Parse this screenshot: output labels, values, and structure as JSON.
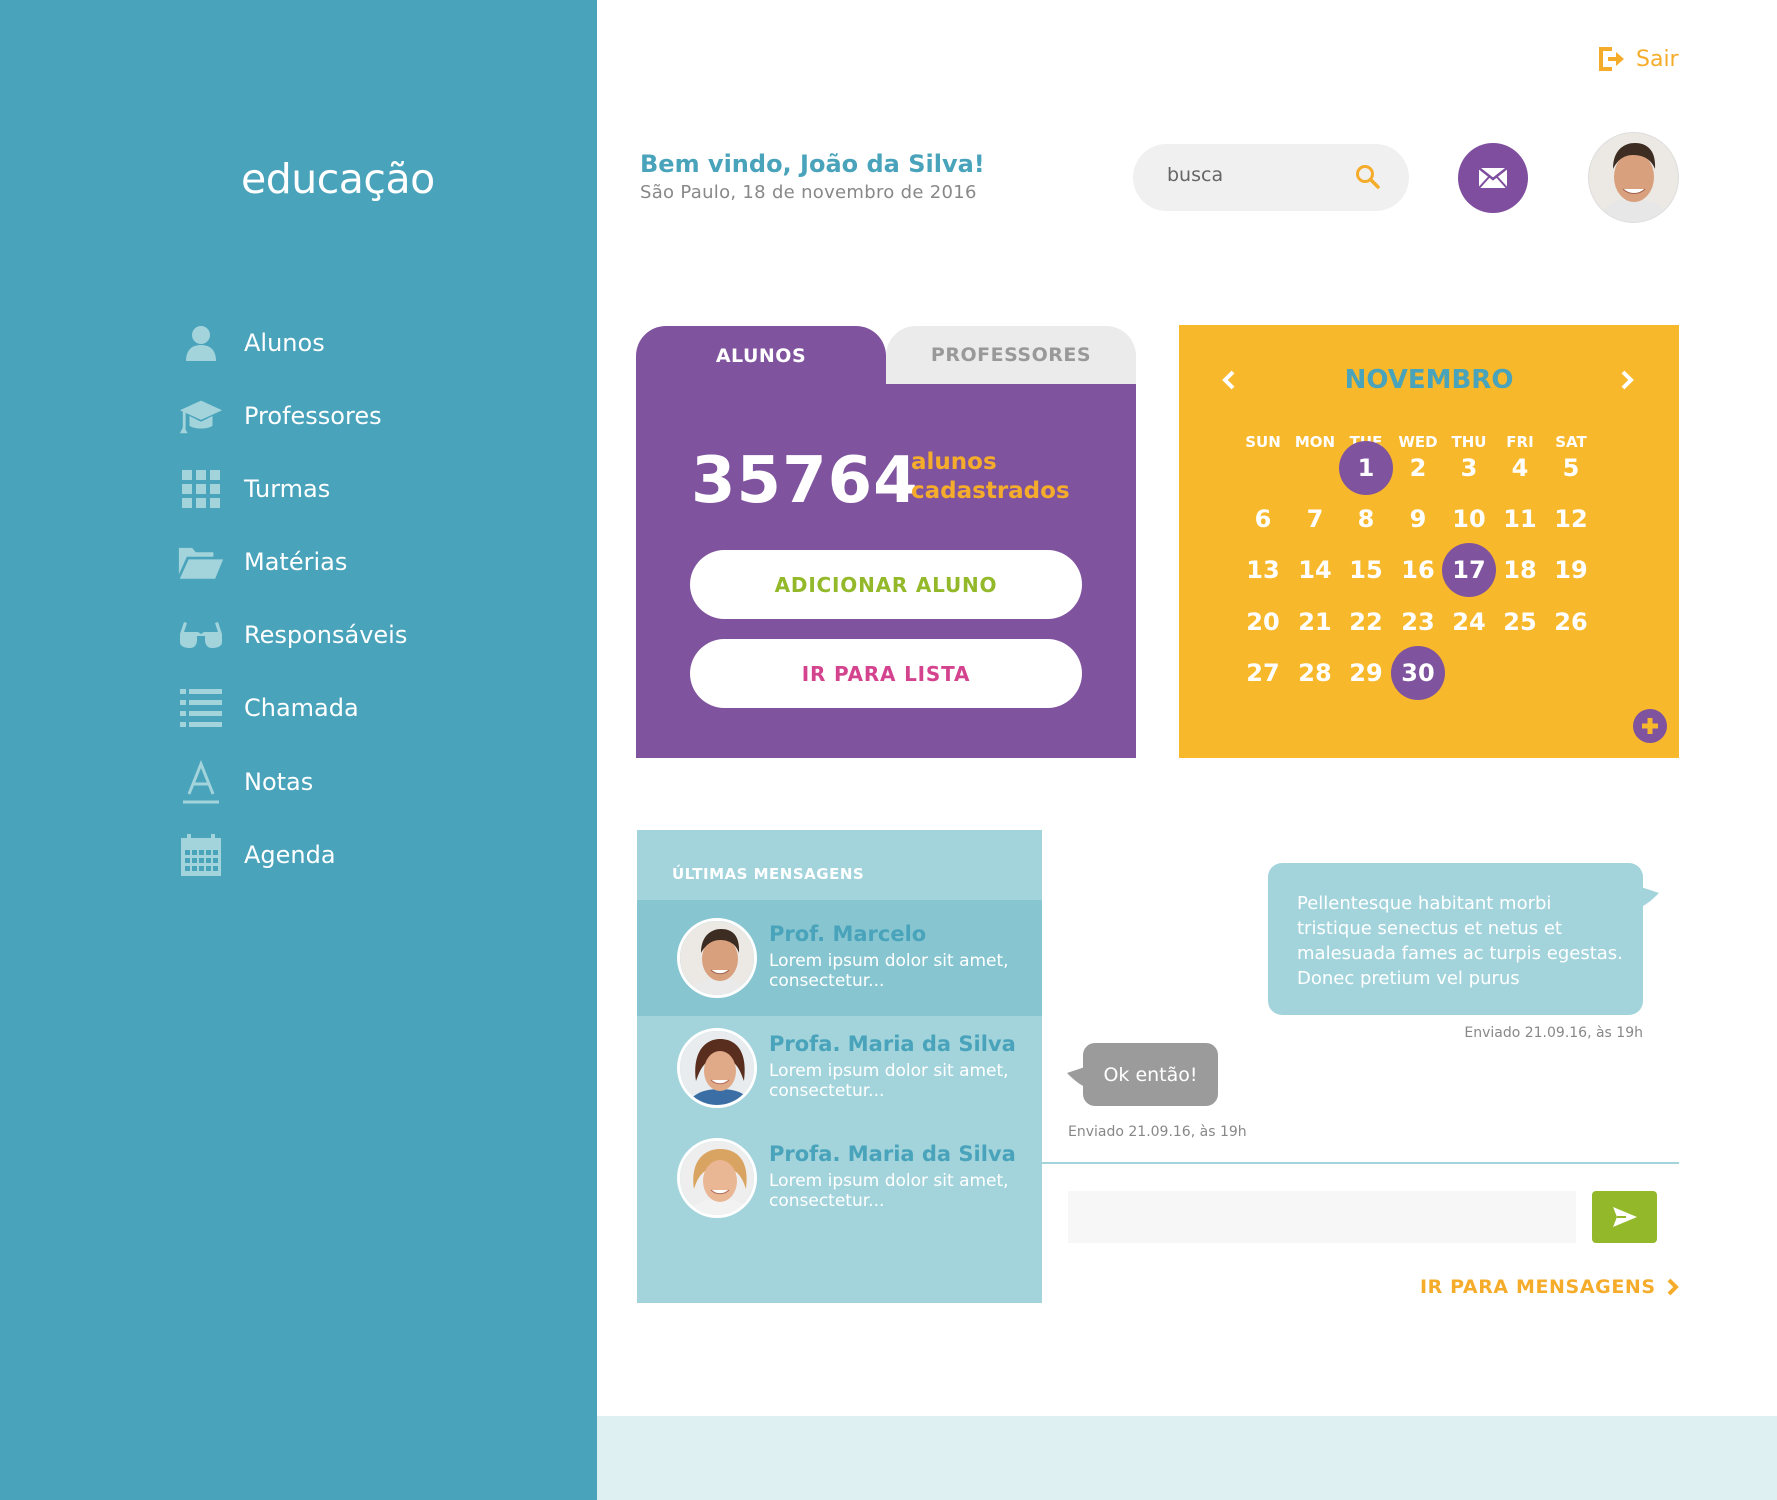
{
  "sidebar": {
    "logo": "educação",
    "items": [
      {
        "label": "Alunos",
        "icon": "user-icon"
      },
      {
        "label": "Professores",
        "icon": "graduation-cap-icon"
      },
      {
        "label": "Turmas",
        "icon": "grid-icon"
      },
      {
        "label": "Matérias",
        "icon": "folder-open-icon"
      },
      {
        "label": "Responsáveis",
        "icon": "glasses-icon"
      },
      {
        "label": "Chamada",
        "icon": "list-icon"
      },
      {
        "label": "Notas",
        "icon": "font-icon"
      },
      {
        "label": "Agenda",
        "icon": "calendar-icon"
      }
    ]
  },
  "header": {
    "logout_label": "Sair",
    "welcome_title": "Bem vindo, João da Silva!",
    "welcome_subtitle": "São Paulo, 18 de novembro de 2016",
    "search_placeholder": "busca"
  },
  "alunos_card": {
    "tab_active": "ALUNOS",
    "tab_inactive": "PROFESSORES",
    "count": "35764",
    "count_label_line1": "alunos",
    "count_label_line2": "cadastrados",
    "add_button": "ADICIONAR ALUNO",
    "list_button": "IR PARA LISTA"
  },
  "calendar": {
    "month": "NOVEMBRO",
    "weekdays": [
      "SUN",
      "MON",
      "TUE",
      "WED",
      "THU",
      "FRI",
      "SAT"
    ],
    "days": [
      "1",
      "2",
      "3",
      "4",
      "5",
      "6",
      "7",
      "8",
      "9",
      "10",
      "11",
      "12",
      "13",
      "14",
      "15",
      "16",
      "17",
      "18",
      "19",
      "20",
      "21",
      "22",
      "23",
      "24",
      "25",
      "26",
      "27",
      "28",
      "29",
      "30"
    ],
    "first_weekday_index": 2,
    "highlighted": [
      "1",
      "17",
      "30"
    ]
  },
  "messages": {
    "title": "ÚLTIMAS MENSAGENS",
    "items": [
      {
        "name": "Prof. Marcelo",
        "preview": "Lorem ipsum dolor sit amet, consectetur..."
      },
      {
        "name": "Profa. Maria da Silva",
        "preview": "Lorem ipsum dolor sit amet, consectetur..."
      },
      {
        "name": "Profa. Maria da Silva",
        "preview": "Lorem ipsum dolor sit amet, consectetur..."
      }
    ]
  },
  "chat": {
    "outgoing_text": "Pellentesque habitant morbi tristique senectus et netus et malesuada fames ac turpis egestas. Donec pretium vel purus",
    "outgoing_meta": "Enviado 21.09.16, às 19h",
    "incoming_text": "Ok então!",
    "incoming_meta": "Enviado 21.09.16, às 19h",
    "input_value": "",
    "goto_label": "IR PARA MENSAGENS"
  },
  "colors": {
    "sidebar": "#48a3bb",
    "purple": "#7f539e",
    "orange": "#f8b82c",
    "green": "#93b92a",
    "pink": "#d4448e",
    "light_blue": "#a3d4dc"
  }
}
